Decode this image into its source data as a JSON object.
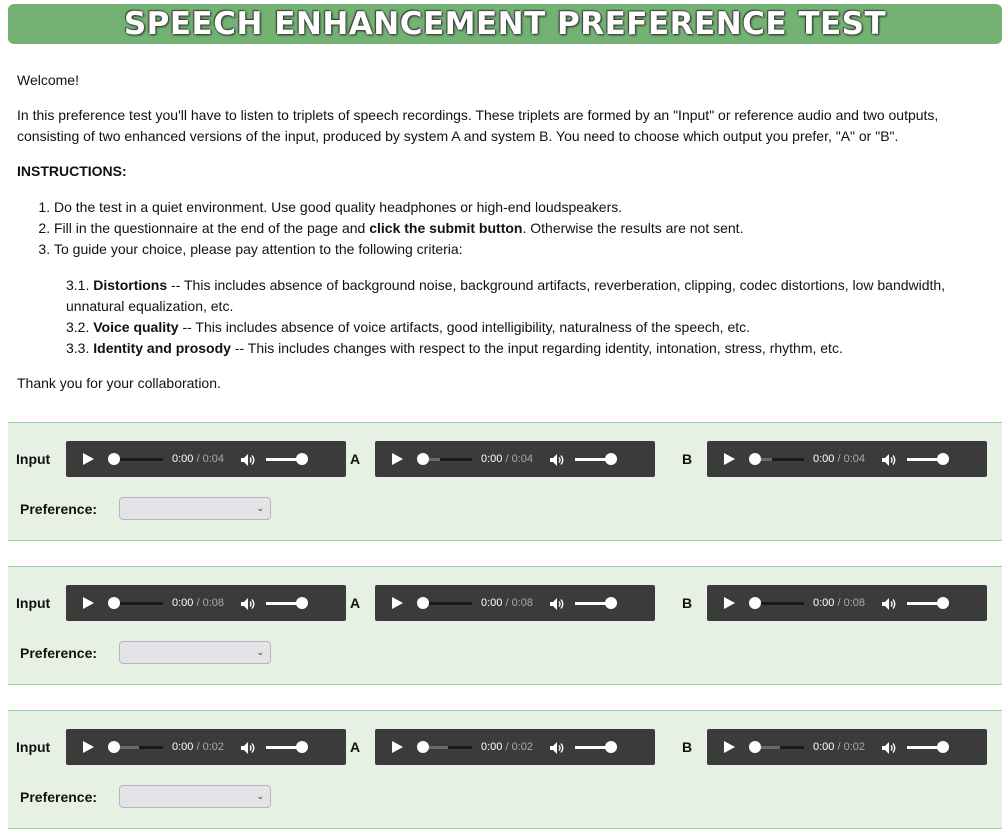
{
  "header": {
    "title": "SPEECH ENHANCEMENT PREFERENCE TEST"
  },
  "intro": {
    "welcome": "Welcome!",
    "description": "In this preference test you'll have to listen to triplets of speech recordings. These triplets are formed by an \"Input\" or reference audio and two outputs, consisting of two enhanced versions of the input, produced by system A and system B. You need to choose which output you prefer, \"A\" or \"B\".",
    "instructions_title": "INSTRUCTIONS:",
    "steps": {
      "s1": "Do the test in a quiet environment. Use good quality headphones or high-end loudspeakers.",
      "s2_pre": "Fill in the questionnaire at the end of the page and ",
      "s2_bold": "click the submit button",
      "s2_post": ". Otherwise the results are not sent.",
      "s3": "To guide your choice, please pay attention to the following criteria:"
    },
    "criteria": [
      {
        "num": "3.1. ",
        "name": "Distortions",
        "text": " -- This includes absence of background noise, background artifacts, reverberation, clipping, codec distortions, low bandwidth, unnatural equalization, etc."
      },
      {
        "num": "3.2. ",
        "name": "Voice quality",
        "text": " -- This includes absence of voice artifacts, good intelligibility, naturalness of the speech, etc."
      },
      {
        "num": "3.3. ",
        "name": "Identity and prosody",
        "text": " -- This includes changes with respect to the input regarding identity, intonation, stress, rhythm, etc."
      }
    ],
    "thanks": "Thank you for your collaboration."
  },
  "labels": {
    "input": "Input",
    "a": "A",
    "b": "B",
    "preference": "Preference:"
  },
  "trials": [
    {
      "players": [
        {
          "current": "0:00",
          "duration": "/ 0:04",
          "buffered": 0.0
        },
        {
          "current": "0:00",
          "duration": "/ 0:04",
          "buffered": 0.4
        },
        {
          "current": "0:00",
          "duration": "/ 0:04",
          "buffered": 0.4
        }
      ],
      "preference": ""
    },
    {
      "players": [
        {
          "current": "0:00",
          "duration": "/ 0:08",
          "buffered": 0.0
        },
        {
          "current": "0:00",
          "duration": "/ 0:08",
          "buffered": 0.0
        },
        {
          "current": "0:00",
          "duration": "/ 0:08",
          "buffered": 0.0
        }
      ],
      "preference": ""
    },
    {
      "players": [
        {
          "current": "0:00",
          "duration": "/ 0:02",
          "buffered": 0.55
        },
        {
          "current": "0:00",
          "duration": "/ 0:02",
          "buffered": 0.55
        },
        {
          "current": "0:00",
          "duration": "/ 0:02",
          "buffered": 0.55
        }
      ],
      "preference": ""
    }
  ],
  "icons": {
    "play": "play-icon",
    "volume": "volume-icon",
    "dropdown": "chevron-down-icon"
  },
  "colors": {
    "header": "#74b274",
    "block_bg": "#e6f1e4",
    "player_bg": "#3b3b3b"
  }
}
